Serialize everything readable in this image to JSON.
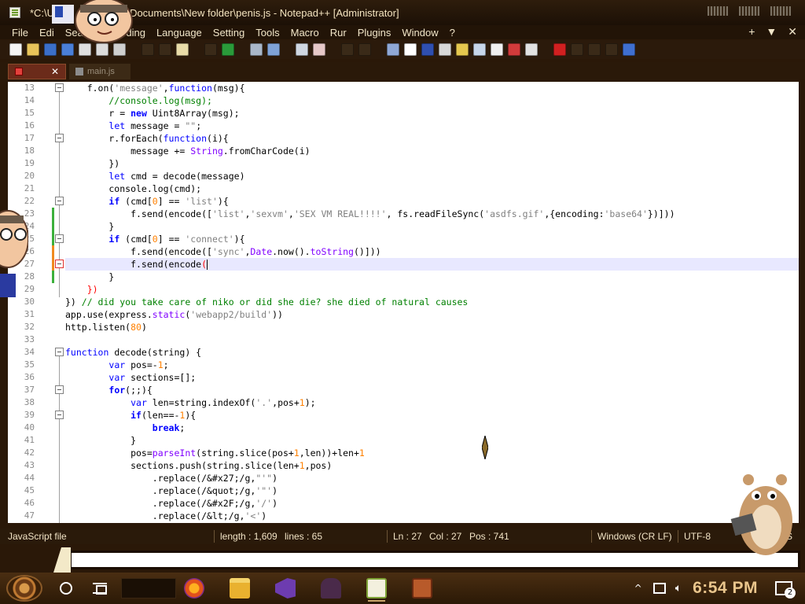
{
  "window": {
    "title_visible": "*C:\\U...Documents\\New folder\\penis.js - Notepad++ [Administrator]",
    "title_left": "*C:\\U",
    "title_right": "Documents\\New folder\\penis.js - Notepad++ [Administrator]"
  },
  "menu": {
    "items": [
      "File",
      "Edit",
      "Search",
      "Encoding",
      "Language",
      "Settings",
      "Tools",
      "Macro",
      "Run",
      "Plugins",
      "Window",
      "?"
    ],
    "visible_labels": [
      "File",
      "Edi",
      "Searc",
      "Encoding",
      "Language",
      "Setting",
      "Tools",
      "Macro",
      "Rur",
      "Plugins",
      "Window",
      "?"
    ],
    "right_plus": "+",
    "right_down": "▼"
  },
  "tabs": {
    "active": {
      "label": "",
      "close": "✕"
    },
    "inactive": {
      "label": "main.js"
    }
  },
  "editor": {
    "lines": [
      {
        "n": "13"
      },
      {
        "n": "14"
      },
      {
        "n": "15"
      },
      {
        "n": "16"
      },
      {
        "n": "17"
      },
      {
        "n": "18"
      },
      {
        "n": "19"
      },
      {
        "n": "20"
      },
      {
        "n": "21"
      },
      {
        "n": "22"
      },
      {
        "n": "23"
      },
      {
        "n": "24"
      },
      {
        "n": "25"
      },
      {
        "n": "26"
      },
      {
        "n": "27"
      },
      {
        "n": "28"
      },
      {
        "n": "29"
      },
      {
        "n": "30"
      },
      {
        "n": "31"
      },
      {
        "n": "32"
      },
      {
        "n": "33"
      },
      {
        "n": "34"
      },
      {
        "n": "35"
      },
      {
        "n": "36"
      },
      {
        "n": "37"
      },
      {
        "n": "38"
      },
      {
        "n": "39"
      },
      {
        "n": "40"
      },
      {
        "n": "41"
      },
      {
        "n": "42"
      },
      {
        "n": "43"
      },
      {
        "n": "44"
      },
      {
        "n": "45"
      },
      {
        "n": "46"
      },
      {
        "n": "47"
      }
    ],
    "code": {
      "l13_a": "    f.on(",
      "l13_s": "'message'",
      "l13_b": ",",
      "l13_k": "function",
      "l13_c": "(msg){",
      "l14": "        //console.log(msg);",
      "l15_a": "        r = ",
      "l15_k": "new",
      "l15_b": " Uint8Array(msg);",
      "l16_k": "let",
      "l16_a": " message = ",
      "l16_s": "\"\"",
      "l16_b": ";",
      "l17_a": "        r.forEach(",
      "l17_k": "function",
      "l17_b": "(i){",
      "l18_a": "            message += ",
      "l18_o": "String",
      "l18_b": ".fromCharCode(i)",
      "l19": "        })",
      "l20_k": "let",
      "l20_a": " cmd = decode(message)",
      "l21": "        console.log(cmd);",
      "l22_k": "if",
      "l22_a": " (cmd[",
      "l22_n": "0",
      "l22_b": "] == ",
      "l22_s": "'list'",
      "l22_c": "){",
      "l23_a": "            f.send(encode([",
      "l23_s1": "'list'",
      "l23_c1": ",",
      "l23_s2": "'sexvm'",
      "l23_c2": ",",
      "l23_s3": "'SEX VM REAL!!!!'",
      "l23_b": ", fs.readFileSync(",
      "l23_s4": "'asdfs.gif'",
      "l23_c": ",{encoding:",
      "l23_s5": "'base64'",
      "l23_d": "})]))",
      "l24": "        }",
      "l25_k": "if",
      "l25_a": " (cmd[",
      "l25_n": "0",
      "l25_b": "] == ",
      "l25_s": "'connect'",
      "l25_c": "){",
      "l26_a": "            f.send(encode([",
      "l26_s": "'sync'",
      "l26_b": ",",
      "l26_o": "Date",
      "l26_c": ".now().",
      "l26_o2": "toString",
      "l26_d": "()]))",
      "l27_a": "            f.send(encode",
      "l27_p": "(",
      "l28": "        }",
      "l29": "    })",
      "l30_a": "}) ",
      "l30_cm": "// did you take care of niko or did she die? she died of natural causes",
      "l31_a": "app.use(express.",
      "l31_o": "static",
      "l31_b": "(",
      "l31_s": "'webapp2/build'",
      "l31_c": "))",
      "l32_a": "http.listen(",
      "l32_n": "80",
      "l32_b": ")",
      "l33": "",
      "l34_k": "function",
      "l34_a": " decode(string) {",
      "l35_k": "var",
      "l35_a": " pos=-",
      "l35_n": "1",
      "l35_b": ";",
      "l36_k": "var",
      "l36_a": " sections=[];",
      "l37_k": "for",
      "l37_a": "(;;){",
      "l38_k": "var",
      "l38_a": " len=string.indexOf(",
      "l38_s": "'.'",
      "l38_b": ",pos+",
      "l38_n": "1",
      "l38_c": ");",
      "l39_k": "if",
      "l39_a": "(len==-",
      "l39_n": "1",
      "l39_b": "){",
      "l40_k": "break",
      "l40_a": ";",
      "l41": "            }",
      "l42_a": "            pos=",
      "l42_o": "parseInt",
      "l42_b": "(string.slice(pos+",
      "l42_n": "1",
      "l42_c": ",len))+len+",
      "l42_n2": "1",
      "l43_a": "            sections.push(string.slice(len+",
      "l43_n": "1",
      "l43_b": ",pos)",
      "l44_a": "                .replace(/&#x27;/g,",
      "l44_s": "\"'\"",
      "l44_b": ")",
      "l45_a": "                .replace(/&quot;/g,",
      "l45_s": "'\"'",
      "l45_b": ")",
      "l46_a": "                .replace(/&#x2F;/g,",
      "l46_s": "'/'",
      "l46_b": ")",
      "l47_a": "                .replace(/&lt;/g,",
      "l47_s": "'<'",
      "l47_b": ")"
    }
  },
  "status": {
    "filetype": "JavaScript file",
    "length": "length : 1,609",
    "lines": "lines : 65",
    "ln": "Ln : 27",
    "col": "Col : 27",
    "pos": "Pos : 741",
    "eol": "Windows (CR LF)",
    "encoding": "UTF-8",
    "mode": "S"
  },
  "taskbar": {
    "clock": "6:54 PM",
    "notifications": "2"
  },
  "colors": {
    "keyword": "#0000ff",
    "string": "#808080",
    "number": "#ff8000",
    "comment": "#008000",
    "object": "#8000ff",
    "clock": "#e9c58c",
    "theme_brown": "#2a1808"
  }
}
